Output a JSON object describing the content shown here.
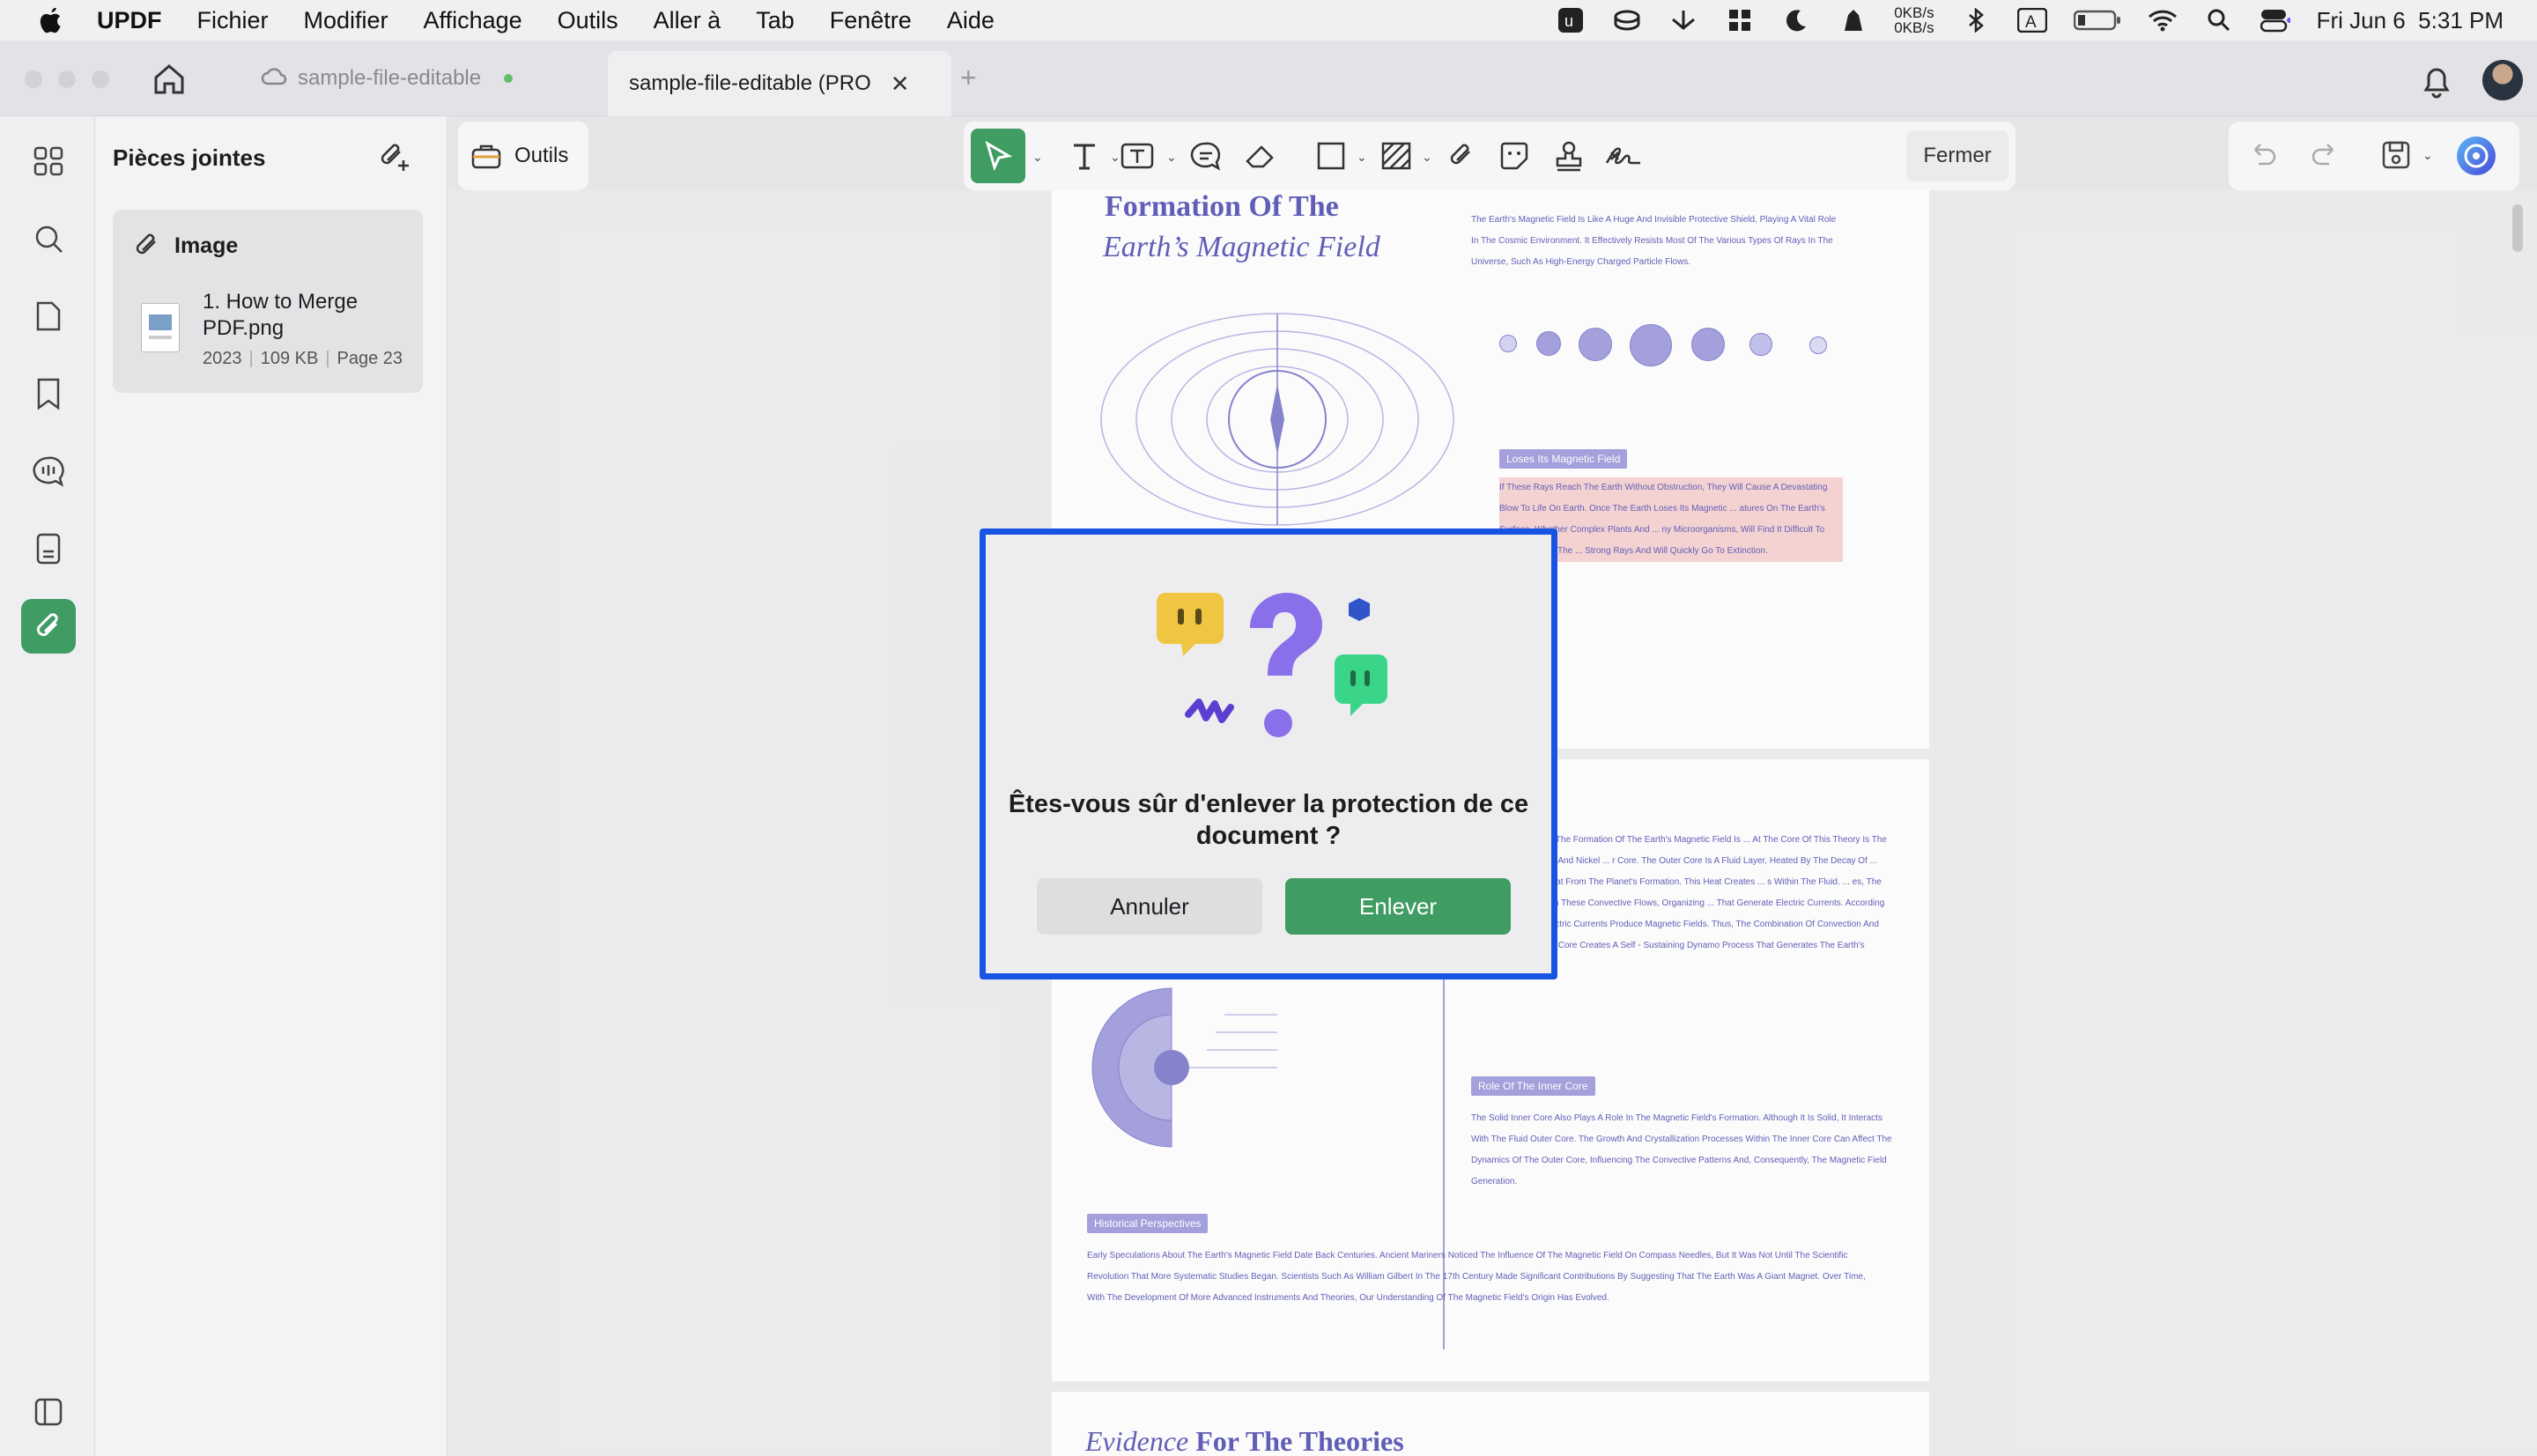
{
  "menubar": {
    "app_name": "UPDF",
    "items": [
      "Fichier",
      "Modifier",
      "Affichage",
      "Outils",
      "Aller à",
      "Tab",
      "Fenêtre",
      "Aide"
    ],
    "net_up": "0KB/s",
    "net_down": "0KB/s",
    "datetime": "Fri Jun 6  5:31 PM"
  },
  "tabs": [
    {
      "label": "sample-file-editable"
    },
    {
      "label": "sample-file-editable (PRO"
    }
  ],
  "panel": {
    "title": "Pièces jointes",
    "attachment": {
      "type_label": "Image",
      "name": "1. How to Merge PDF.png",
      "date": "2023",
      "size": "109 KB",
      "page": "Page 23"
    }
  },
  "toolbar": {
    "outils_label": "Outils",
    "close_label": "Fermer"
  },
  "pdf": {
    "title_line1": "Formation Of The",
    "title_line2": "Earth’s Magnetic Field",
    "page1_para": "The Earth's Magnetic Field Is Like A Huge And Invisible Protective Shield, Playing A Vital Role In The Cosmic Environment. It Effectively Resists Most Of The Various Types Of Rays In The Universe, Such As High-Energy Charged Particle Flows.",
    "loses_label": "Loses Its Magnetic Field",
    "page1_highlight": "If These Rays Reach The Earth Without Obstruction, They Will Cause A Devastating Blow To Life On Earth. Once The Earth Loses Its Magnetic ... atures On The Earth's Surface, Whether Complex Plants And ... ny Microorganisms, Will Find It Difficult To Survive Under The ... Strong Rays And Will Quickly Go To Extinction.",
    "page2_para1": "Accepted Theory For The Formation Of The Earth's Magnetic Field Is ... At The Core Of This Theory Is The Motion Of Molten Iron And Nickel ... r Core. The Outer Core Is A Fluid Layer, Heated By The Decay Of ... ents And Residual Heat From The Planet's Formation. This Heat Creates ... s Within The Fluid. ... es, The Coriolis Force Acts On These Convective Flows, Organizing ... That Generate Electric Currents. According To Ampere's Law, Electric Currents Produce Magnetic Fields. Thus, The Combination Of Convection And Rotation In The Outer Core Creates A Self - Sustaining Dynamo Process That Generates The Earth's Magnetic Field.",
    "inner_core_label": "Role Of The Inner Core",
    "inner_core_para": "The Solid Inner Core Also Plays A Role In The Magnetic Field's Formation. Although It Is Solid, It Interacts With The Fluid Outer Core. The Growth And Crystallization Processes Within The Inner Core Can Affect The Dynamics Of The Outer Core, Influencing The Convective Patterns And, Consequently, The Magnetic Field Generation.",
    "historical_label": "Historical Perspectives",
    "historical_para": "Early Speculations About The Earth's Magnetic Field Date Back Centuries. Ancient Mariners Noticed The Influence Of The Magnetic Field On Compass Needles, But It Was Not Until The Scientific Revolution That More Systematic Studies Began. Scientists Such As William Gilbert In The 17th Century Made Significant Contributions By Suggesting That The Earth Was A Giant Magnet. Over Time, With The Development Of More Advanced Instruments And Theories, Our Understanding Of The Magnetic Field's Origin Has Evolved.",
    "page3_title_italic": "Evidence",
    "page3_title_rest": "For The Theories"
  },
  "dialog": {
    "question": "Êtes-vous sûr d'enlever la protection de ce document ?",
    "cancel_label": "Annuler",
    "confirm_label": "Enlever"
  },
  "colors": {
    "accent_green": "#3f9c62",
    "dialog_border": "#1854e4",
    "pdf_blue": "#3d3ba8"
  }
}
